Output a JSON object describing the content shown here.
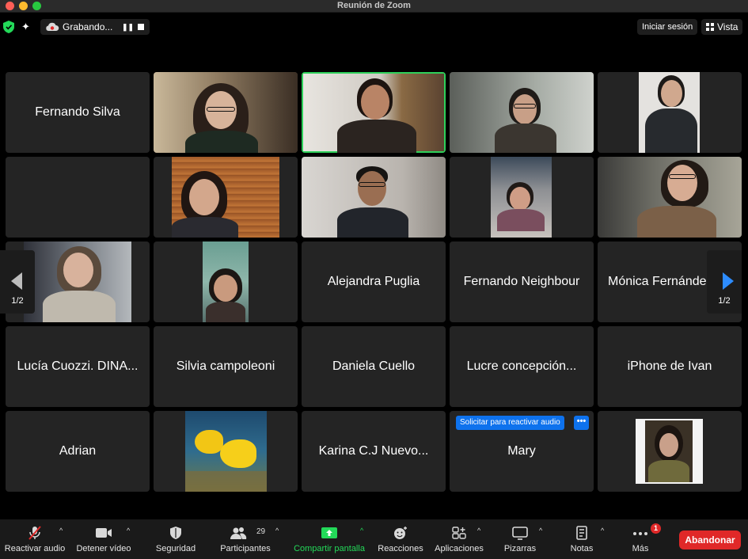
{
  "window": {
    "title": "Reunión de Zoom"
  },
  "topbar": {
    "recording_label": "Grabando...",
    "signin_label": "Iniciar sesión",
    "view_label": "Vista"
  },
  "pager": {
    "left_page": "1/2",
    "right_page": "1/2"
  },
  "tiles": {
    "fernando_silva": "Fernando Silva",
    "alejandra": "Alejandra Puglia",
    "fernando_n": "Fernando Neighbour",
    "monica": "Mónica Fernández",
    "lucia": "Lucía Cuozzi. DINA...",
    "silvia": "Silvia campoleoni",
    "daniela": "Daniela Cuello",
    "lucre": "Lucre concepción...",
    "iphone": "iPhone de Ivan",
    "adrian": "Adrian",
    "karina": "Karina C.J Nuevo...",
    "mary": "Mary",
    "mary_request": "Solicitar para reactivar audio",
    "mary_more": "•••"
  },
  "toolbar": {
    "unmute": "Reactivar audio",
    "stop_video": "Detener vídeo",
    "security": "Seguridad",
    "participants": "Participantes",
    "participants_count": "29",
    "share": "Compartir pantalla",
    "reactions": "Reacciones",
    "apps": "Aplicaciones",
    "whiteboards": "Pizarras",
    "notes": "Notas",
    "more": "Más",
    "more_badge": "1",
    "leave": "Abandonar"
  },
  "colors": {
    "active_speaker": "#2ed05a",
    "share_green": "#23d959",
    "leave_red": "#e02828",
    "request_blue": "#0e72ed"
  }
}
